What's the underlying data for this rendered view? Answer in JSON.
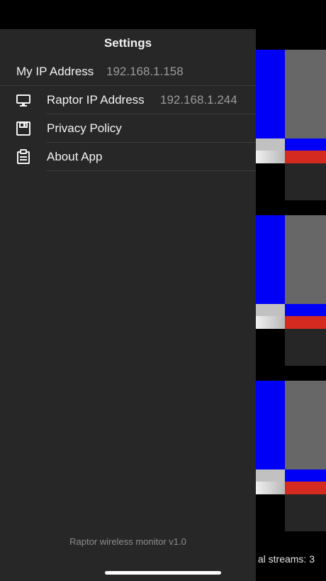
{
  "drawer": {
    "title": "Settings",
    "my_ip": {
      "label": "My IP Address",
      "value": "192.168.1.158"
    },
    "items": [
      {
        "icon": "monitor-icon",
        "label": "Raptor IP Address",
        "value": "192.168.1.244"
      },
      {
        "icon": "save-icon",
        "label": "Privacy Policy",
        "value": ""
      },
      {
        "icon": "clipboard-icon",
        "label": "About App",
        "value": ""
      }
    ],
    "version": "Raptor wireless monitor v1.0"
  },
  "background": {
    "streams_label": "al streams: 3"
  },
  "colors": {
    "drawer_bg": "#272727",
    "text_primary": "#f2f2f2",
    "text_secondary": "#9a9a9a",
    "stream_blue": "#0000f6",
    "stream_gray": "#676767",
    "stream_red": "#d42a20"
  }
}
